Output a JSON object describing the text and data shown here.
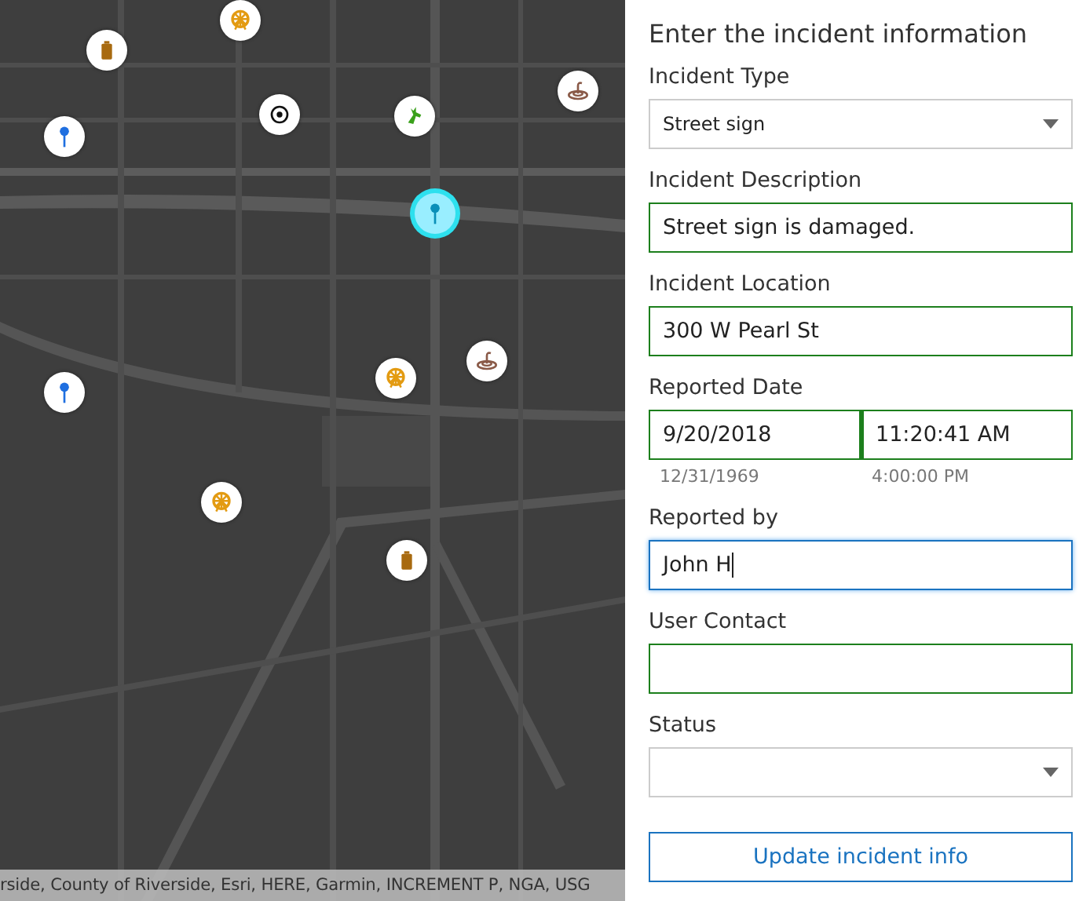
{
  "map": {
    "markers": [
      {
        "kind": "ferris-wheel",
        "selected": false
      },
      {
        "kind": "can",
        "selected": false
      },
      {
        "kind": "pin",
        "selected": false
      },
      {
        "kind": "target",
        "selected": false
      },
      {
        "kind": "deer",
        "selected": false
      },
      {
        "kind": "snake",
        "selected": false
      },
      {
        "kind": "pin",
        "selected": true
      },
      {
        "kind": "ferris-wheel",
        "selected": false
      },
      {
        "kind": "snake",
        "selected": false
      },
      {
        "kind": "pin",
        "selected": false
      },
      {
        "kind": "ferris-wheel",
        "selected": false
      },
      {
        "kind": "can",
        "selected": false
      }
    ],
    "attribution": "rside, County of Riverside, Esri, HERE, Garmin, INCREMENT P, NGA, USG"
  },
  "form": {
    "title": "Enter the incident information",
    "fields": [
      {
        "kind": "select",
        "label": "Incident Type",
        "value": "Street sign",
        "valid": false,
        "focused": false
      },
      {
        "kind": "text",
        "label": "Incident Description",
        "value": "Street sign is damaged.",
        "valid": true,
        "focused": false
      },
      {
        "kind": "text",
        "label": "Incident Location",
        "value": "300 W Pearl St",
        "valid": true,
        "focused": false
      },
      {
        "kind": "datetime",
        "label": "Reported Date",
        "date": "9/20/2018",
        "time": "11:20:41 AM",
        "date_hint": "12/31/1969",
        "time_hint": "4:00:00 PM",
        "valid": true,
        "focused": false
      },
      {
        "kind": "text",
        "label": "Reported by",
        "value": "John H",
        "valid": false,
        "focused": true
      },
      {
        "kind": "text",
        "label": "User Contact",
        "valid": true,
        "focused": false
      },
      {
        "kind": "select",
        "label": "Status",
        "valid": false,
        "focused": false
      }
    ],
    "button": "Update incident info"
  }
}
